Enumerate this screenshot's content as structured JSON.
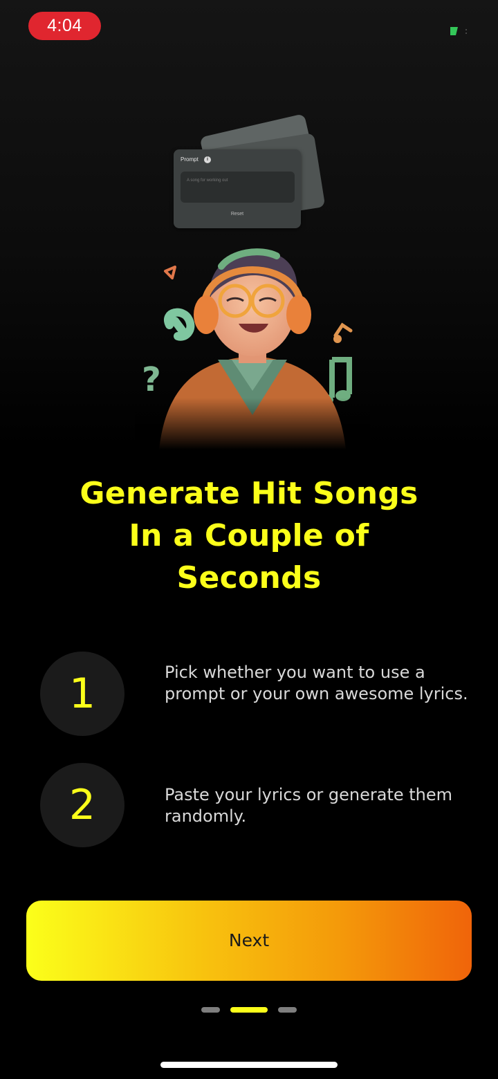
{
  "status_bar": {
    "time": "4:04",
    "battery_color": "#34c759",
    "time_pill_color": "#e0262f"
  },
  "illustration": {
    "prompt_card": {
      "title": "Prompt",
      "info_icon": "info-icon",
      "placeholder": "A song for working out",
      "reset_label": "Reset"
    },
    "character": "person-with-headphones-illustration"
  },
  "headline": {
    "line1": "Generate Hit Songs",
    "line2": "In a Couple of",
    "line3": "Seconds",
    "color": "#fbff1a"
  },
  "steps": [
    {
      "number": "1",
      "text": "Pick whether you want to use a prompt or your own awesome lyrics."
    },
    {
      "number": "2",
      "text": "Paste your lyrics or generate them randomly."
    }
  ],
  "next_button": {
    "label": "Next"
  },
  "pagination": {
    "total": 3,
    "active_index": 1
  }
}
